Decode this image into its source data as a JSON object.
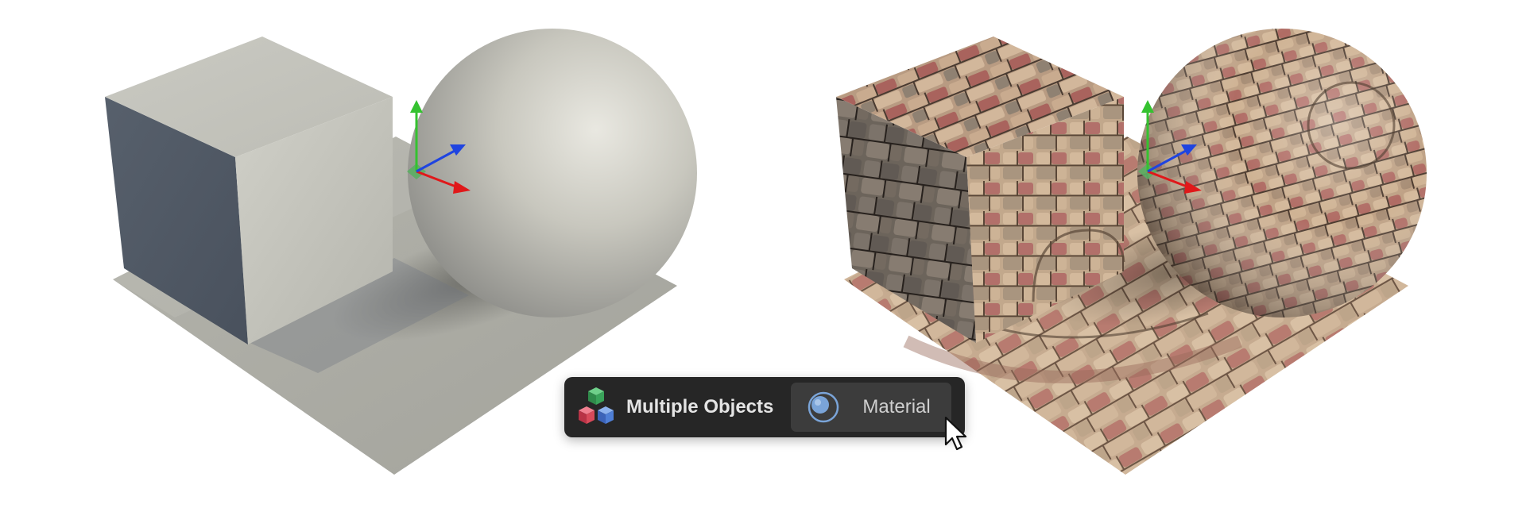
{
  "toolbar": {
    "selection_label": "Multiple Objects",
    "material_label": "Material"
  },
  "icons": {
    "selection": "cubes-icon",
    "material": "material-sphere-icon",
    "cursor": "mouse-pointer-icon"
  },
  "colors": {
    "toolbar_background": "#262626",
    "button_background": "#3c3c3c",
    "axis_x": "#e0181a",
    "axis_y": "#35c230",
    "axis_z": "#1f44e0",
    "cube_green": "#3aa35a",
    "cube_red": "#d84a5a",
    "cube_blue": "#4f7fd6",
    "material_accent": "#7aa4d8"
  }
}
